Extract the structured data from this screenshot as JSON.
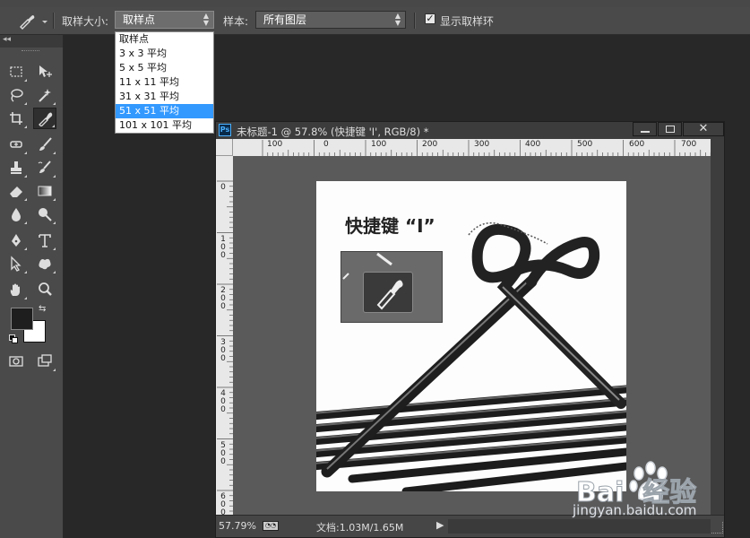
{
  "options_bar": {
    "sample_size_label": "取样大小:",
    "sample_size_value": "取样点",
    "sample_label": "样本:",
    "sample_value": "所有图层",
    "show_ring_label": "显示取样环",
    "show_ring_checked": true
  },
  "dropdown": {
    "items": [
      "取样点",
      "3 x 3 平均",
      "5 x 5 平均",
      "11 x 11 平均",
      "31 x 31 平均",
      "51 x 51 平均",
      "101 x 101 平均"
    ],
    "highlighted_index": 5
  },
  "document": {
    "badge": "Ps",
    "title": "未标题-1 @ 57.8% (快捷键 'I', RGB/8) *",
    "ruler_h": [
      "100",
      "0",
      "100",
      "200",
      "300",
      "400",
      "500",
      "600",
      "700"
    ],
    "ruler_v": [
      "0",
      "100",
      "200",
      "300",
      "400",
      "500",
      "600"
    ],
    "zoom": "57.79%",
    "doc_info": "文档:1.03M/1.65M"
  },
  "image": {
    "caption": "快捷键 “I”"
  },
  "watermark": {
    "brand_text": "Bai  经验",
    "url": "jingyan.baidu.com"
  },
  "colors": {
    "foreground": "#1e1e1e",
    "background": "#ffffff",
    "highlight": "#3399ff"
  }
}
